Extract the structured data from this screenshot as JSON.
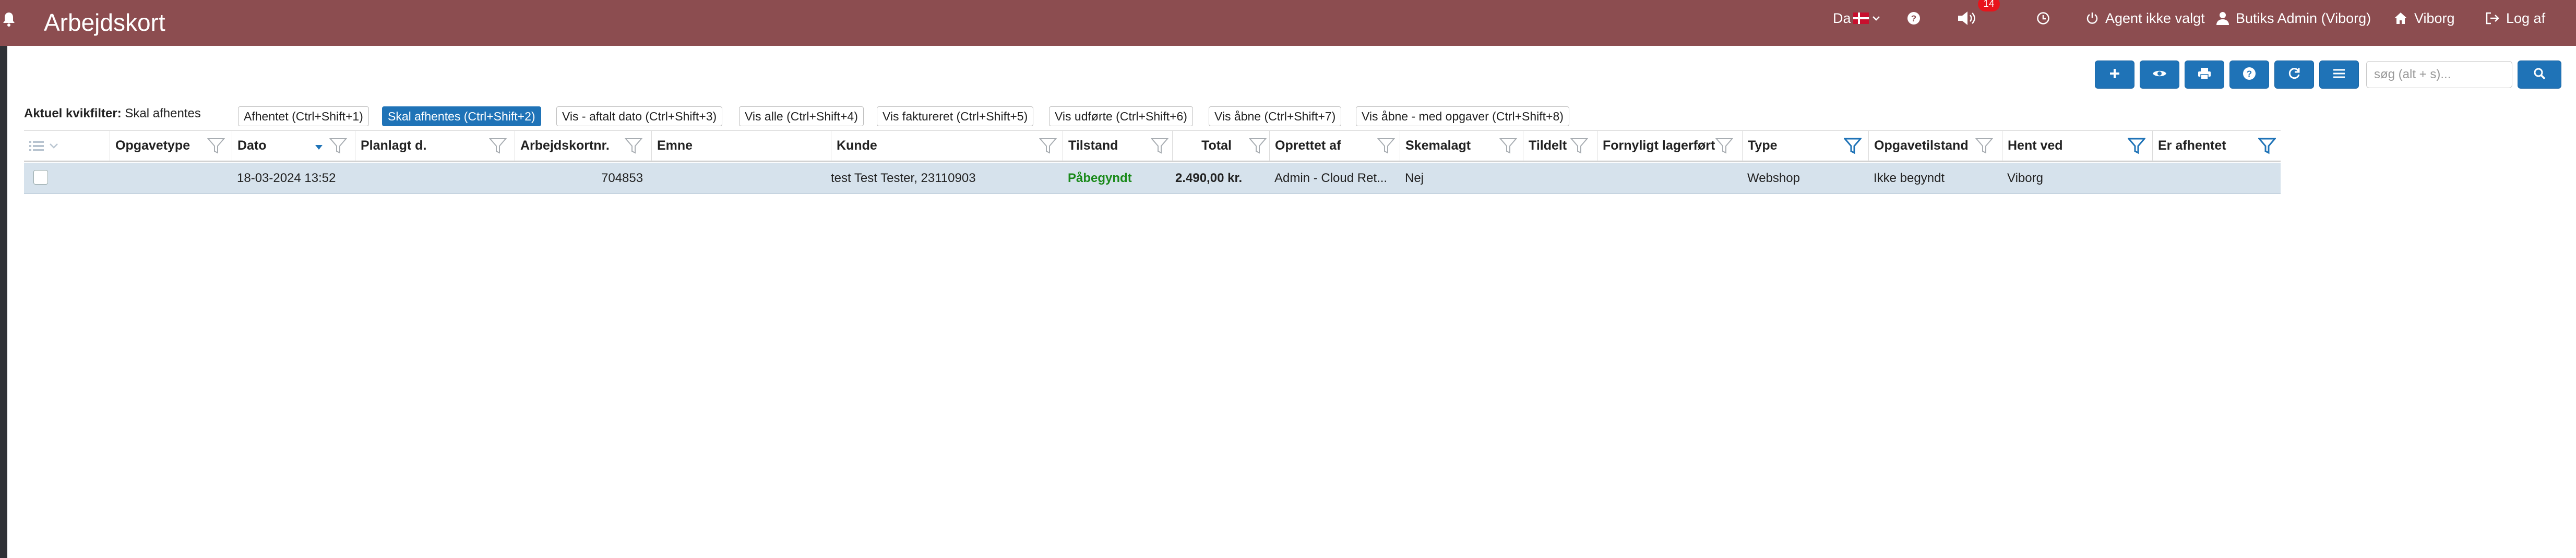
{
  "header": {
    "title": "Arbejdskort",
    "language": "Da",
    "notification_count": "14",
    "agent_status": "Agent ikke valgt",
    "user": "Butiks Admin (Viborg)",
    "store": "Viborg",
    "logout": "Log af"
  },
  "toolbar": {
    "search_placeholder": "søg (alt + s)..."
  },
  "quick_filter": {
    "label": "Aktuel kvikfilter:",
    "value": "Skal afhentes",
    "buttons": [
      "Afhentet (Ctrl+Shift+1)",
      "Skal afhentes (Ctrl+Shift+2)",
      "Vis - aftalt dato (Ctrl+Shift+3)",
      "Vis alle (Ctrl+Shift+4)",
      "Vis faktureret (Ctrl+Shift+5)",
      "Vis udførte (Ctrl+Shift+6)",
      "Vis åbne (Ctrl+Shift+7)",
      "Vis åbne - med opgaver (Ctrl+Shift+8)"
    ],
    "active_index": 1
  },
  "grid": {
    "columns": [
      "Opgavetype",
      "Dato",
      "Planlagt d.",
      "Arbejdskortnr.",
      "Emne",
      "Kunde",
      "Tilstand",
      "Total",
      "Oprettet af",
      "Skemalagt",
      "Tildelt",
      "Fornyligt lagerført",
      "Type",
      "Opgavetilstand",
      "Hent ved",
      "Er afhentet"
    ],
    "rows": [
      {
        "opgavetype": "",
        "dato": "18-03-2024 13:52",
        "planlagt": "",
        "arbejdskortnr": "704853",
        "emne": "",
        "kunde": "test Test Tester, 23110903",
        "tilstand": "Påbegyndt",
        "total": "2.490,00 kr.",
        "oprettet_af": "Admin - Cloud Ret...",
        "skemalagt": "Nej",
        "tildelt": "",
        "fornyligt_lagerfoert": "",
        "type": "Webshop",
        "opgavetilstand": "Ikke begyndt",
        "hent_ved": "Viborg",
        "er_afhentet": ""
      }
    ]
  },
  "colors": {
    "header_bg": "#8c4d50",
    "primary": "#1f73b7",
    "row_selected": "#d6e2ec",
    "status_green": "#1a8a1a",
    "badge_red": "#e8141b"
  },
  "icons": {
    "bell": "bell-icon",
    "flag": "danish-flag-icon",
    "help": "help-icon",
    "sound": "speaker-icon",
    "clock": "clock-icon",
    "power": "power-icon",
    "user": "user-icon",
    "home": "home-icon",
    "logout": "logout-icon",
    "add": "plus-icon",
    "view": "eye-icon",
    "print": "printer-icon",
    "refresh": "refresh-icon",
    "menu": "menu-icon",
    "search": "search-icon",
    "filter": "filter-icon"
  }
}
